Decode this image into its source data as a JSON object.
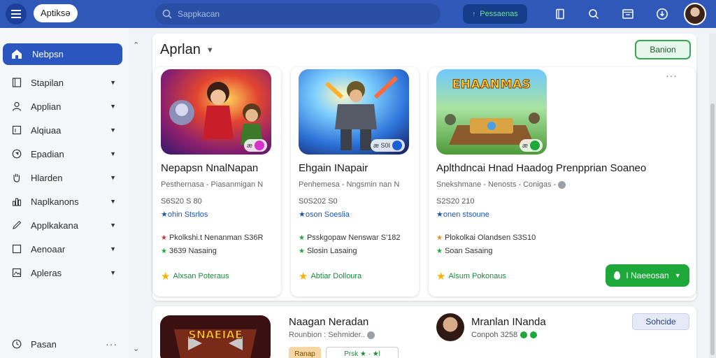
{
  "topbar": {
    "app_name": "Aptiksə",
    "search_placeholder": "Sappkacan",
    "action_button": "Pessaenas",
    "icons": [
      "menu-icon",
      "search-icon",
      "document-icon",
      "zoom-icon",
      "window-icon",
      "download-icon"
    ]
  },
  "sidebar": {
    "active_label": "Nebpsn",
    "items": [
      {
        "label": "Stapilan",
        "icon": "tablet-icon"
      },
      {
        "label": "Applian",
        "icon": "person-icon"
      },
      {
        "label": "Alqiuaa",
        "icon": "box-icon"
      },
      {
        "label": "Epadian",
        "icon": "compass-icon"
      },
      {
        "label": "Hlarden",
        "icon": "hand-icon"
      },
      {
        "label": "Naplkanons",
        "icon": "chart-icon"
      },
      {
        "label": "Applkakana",
        "icon": "pen-icon"
      },
      {
        "label": "Aenoaar",
        "icon": "square-icon"
      },
      {
        "label": "Apleras",
        "icon": "image-icon"
      }
    ],
    "bottom_label": "Pasan",
    "bottom_more": "···"
  },
  "main": {
    "title": "Aprlan",
    "header_button": "Banion",
    "more": "···",
    "cards": [
      {
        "title": "Nepapsn NnalNapan",
        "subtitle": "Pesthernasa - Piasanmigan N",
        "meta": "S6S20 S 80",
        "link": "★ohin Stsrlos",
        "line1": "Pkolkshi.t Nenanman S36R",
        "line2": "3639 Nasaing",
        "rating_label": "Alxsan Poteraus",
        "badge": "æ"
      },
      {
        "title": "Ehgain INapair",
        "subtitle": "Penhemesa - Nngsmin nan N",
        "meta": "S0S202 S0",
        "link": "★oson Soeslia",
        "line1": "Psskgopaw Nenswar S'182",
        "line2": "Slosin Lasaing",
        "rating_label": "Abtiar Dolloura",
        "badge": "æ S0I"
      },
      {
        "title": "Aplthdncai Hnad Haadog Prenpprian Soaneo",
        "subtitle": "Snekshmane - Nenosts - Conigas -",
        "meta": "S2S20 210",
        "link": "★onen stsoune",
        "line1": "Plokolkai Olandsen S3S10",
        "line2": "Soan Sasaing",
        "rating_label": "Alsum Pokonaus",
        "badge": "æ",
        "thumb_text": "EHAANMAS",
        "install_label": "I Naeeosan"
      }
    ]
  },
  "second": {
    "title": "Naagan Neradan",
    "subtitle": "Rounbion : Sehmider..",
    "chip1": "Ranap",
    "chip2": "Prsk ★ · ★l",
    "name": "Mranlan INanda",
    "meta": "Conpoh 3258",
    "button": "Sohcide",
    "thumb_text": "SNAEIAE"
  },
  "colors": {
    "topbar": "#2f58b8",
    "accent_blue": "#2b56c0",
    "accent_green": "#1fa83a",
    "star": "#f2b400",
    "link": "#1a56b8"
  }
}
